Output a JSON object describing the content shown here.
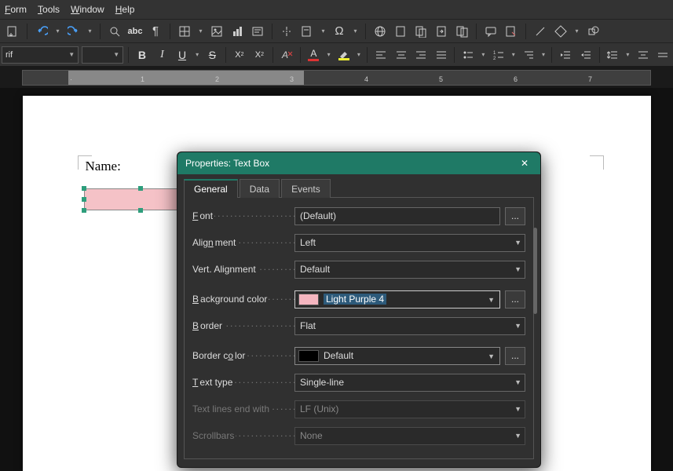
{
  "menu": {
    "items": [
      "Form",
      "Tools",
      "Window",
      "Help"
    ]
  },
  "format": {
    "font_name": "rif",
    "font_size": ""
  },
  "document": {
    "label": "Name:"
  },
  "dialog": {
    "title": "Properties: Text Box",
    "tabs": [
      "General",
      "Data",
      "Events"
    ],
    "active_tab": 0,
    "close_glyph": "✕",
    "rows": {
      "font": {
        "label": "Font",
        "value": "(Default)"
      },
      "alignment": {
        "label": "Alignment",
        "value": "Left"
      },
      "valign": {
        "label": "Vert. Alignment",
        "value": "Default"
      },
      "bgcolor": {
        "label": "Background color",
        "value": "Light Purple 4",
        "swatch": "#f5b6c0"
      },
      "border": {
        "label": "Border",
        "value": "Flat"
      },
      "bordercolor": {
        "label": "Border color",
        "value": "Default",
        "swatch": "#000000"
      },
      "texttype": {
        "label": "Text type",
        "value": "Single-line"
      },
      "lineend": {
        "label": "Text lines end with",
        "value": "LF (Unix)"
      },
      "scrollbars": {
        "label": "Scrollbars",
        "value": "None"
      }
    },
    "dots": "..."
  },
  "ruler": {
    "numbers": [
      "1",
      "2",
      "3",
      "4",
      "5",
      "6",
      "7"
    ]
  },
  "colors": {
    "accent": "#1f7a66",
    "selection": "#2d5a7a",
    "textbox_bg": "#f5c2c7"
  }
}
